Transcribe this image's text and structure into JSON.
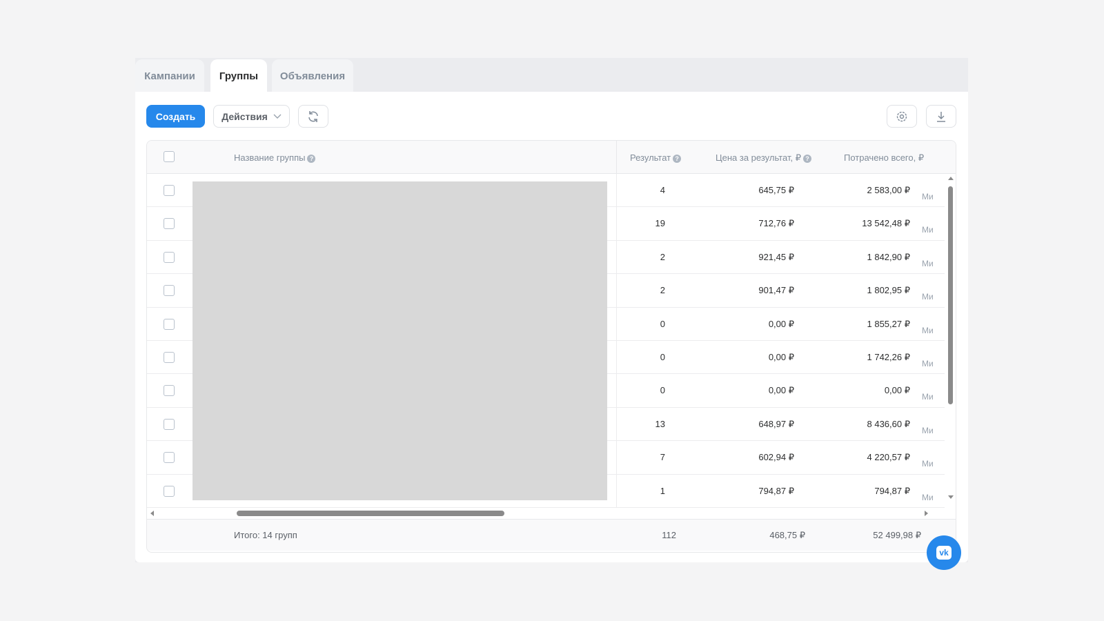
{
  "tabs": [
    {
      "label": "Кампании"
    },
    {
      "label": "Группы"
    },
    {
      "label": "Объявления"
    }
  ],
  "toolbar": {
    "create": "Создать",
    "actions": "Действия"
  },
  "columns": {
    "name": "Название группы",
    "result": "Результат",
    "price": "Цена за результат, ₽",
    "spent": "Потрачено всего, ₽",
    "extra": "Ми"
  },
  "rows": [
    {
      "result": "4",
      "price": "645,75 ₽",
      "spent": "2 583,00 ₽"
    },
    {
      "result": "19",
      "price": "712,76 ₽",
      "spent": "13 542,48 ₽"
    },
    {
      "result": "2",
      "price": "921,45 ₽",
      "spent": "1 842,90 ₽"
    },
    {
      "result": "2",
      "price": "901,47 ₽",
      "spent": "1 802,95 ₽"
    },
    {
      "result": "0",
      "price": "0,00 ₽",
      "spent": "1 855,27 ₽"
    },
    {
      "result": "0",
      "price": "0,00 ₽",
      "spent": "1 742,26 ₽"
    },
    {
      "result": "0",
      "price": "0,00 ₽",
      "spent": "0,00 ₽"
    },
    {
      "result": "13",
      "price": "648,97 ₽",
      "spent": "8 436,60 ₽"
    },
    {
      "result": "7",
      "price": "602,94 ₽",
      "spent": "4 220,57 ₽"
    },
    {
      "result": "1",
      "price": "794,87 ₽",
      "spent": "794,87 ₽"
    }
  ],
  "footer": {
    "label": "Итого: 14 групп",
    "result": "112",
    "price": "468,75 ₽",
    "spent": "52 499,98 ₽"
  },
  "colors": {
    "accent": "#2688eb"
  }
}
